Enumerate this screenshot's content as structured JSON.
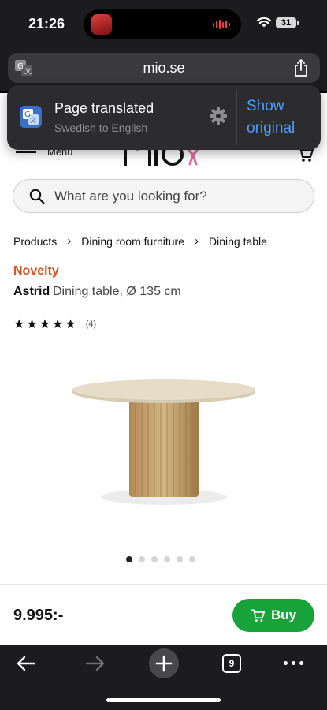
{
  "status": {
    "time": "21:26",
    "battery": "31"
  },
  "browser": {
    "url": "mio.se",
    "icons": {
      "translate": "translate-icon",
      "share": "share-icon"
    },
    "tab_count": "9",
    "bottom_icons": [
      "back-arrow-icon",
      "forward-arrow-icon",
      "plus-icon",
      "tabs-icon",
      "more-icon"
    ]
  },
  "translation": {
    "title": "Page translated",
    "subtitle": "Swedish to English",
    "show_original": "Show original"
  },
  "header": {
    "menu_label": "Menu"
  },
  "search": {
    "placeholder": "What are you looking for?"
  },
  "breadcrumb": [
    "Products",
    "Dining room furniture",
    "Dining table"
  ],
  "product": {
    "badge": "Novelty",
    "name": "Astrid",
    "description": "Dining table, Ø 135 cm",
    "rating_stars": 5,
    "review_count": "(4)",
    "image_count": 6,
    "active_image": 1,
    "price": "9.995:-",
    "buy_label": "Buy"
  },
  "colors": {
    "accent_green": "#17a33a",
    "badge_orange": "#d9501e",
    "link_blue": "#4a9eff",
    "chrome": "#1c1c1e"
  }
}
